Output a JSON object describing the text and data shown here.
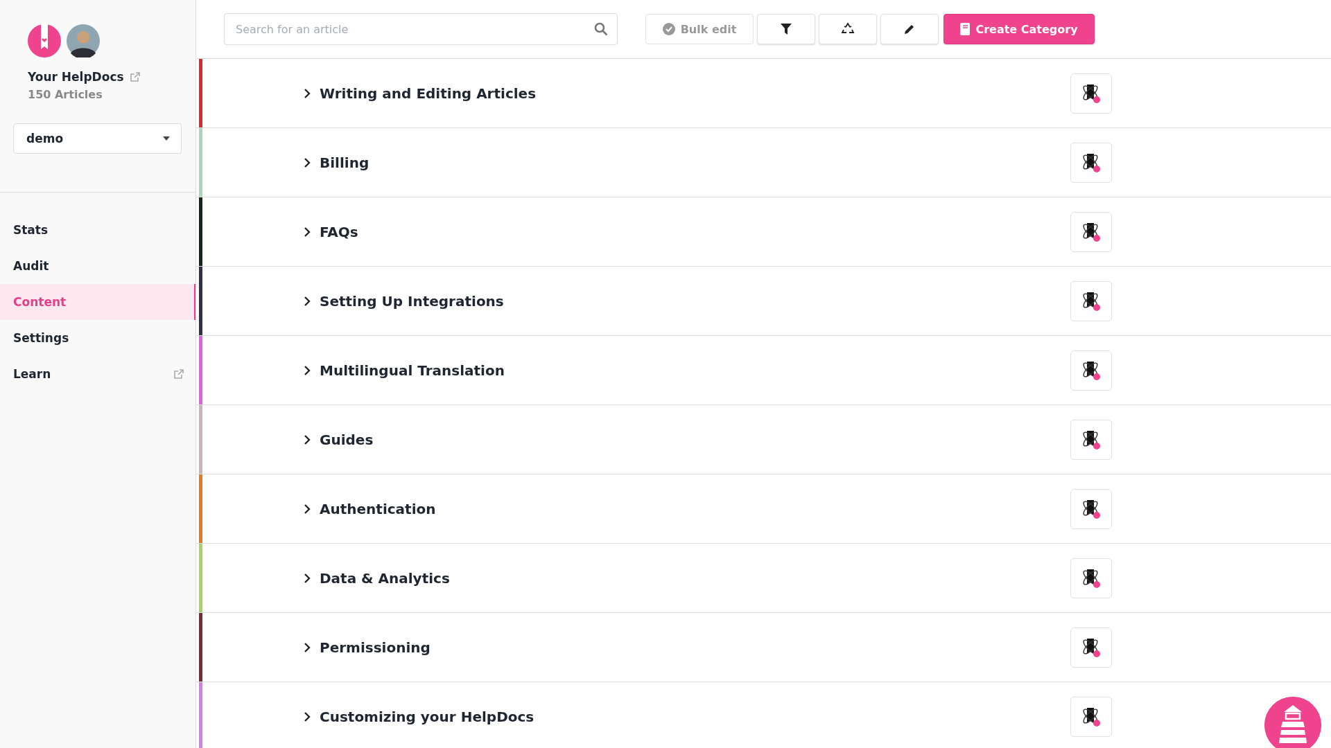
{
  "sidebar": {
    "site_name": "Your HelpDocs",
    "article_count": "150 Articles",
    "project_select": {
      "value": "demo"
    },
    "nav": [
      {
        "label": "Stats",
        "selected": false,
        "external": false
      },
      {
        "label": "Audit",
        "selected": false,
        "external": false
      },
      {
        "label": "Content",
        "selected": true,
        "external": false
      },
      {
        "label": "Settings",
        "selected": false,
        "external": false
      },
      {
        "label": "Learn",
        "selected": false,
        "external": true
      }
    ]
  },
  "toolbar": {
    "search": {
      "placeholder": "Search for an article"
    },
    "bulk_edit": "Bulk edit",
    "create_button": "Create Category"
  },
  "categories": [
    {
      "title": "Writing and Editing Articles",
      "color": "#e0262f",
      "expanded": false
    },
    {
      "title": "Billing",
      "color": "#a9d6bd",
      "expanded": false
    },
    {
      "title": "FAQs",
      "color": "#1b2418",
      "expanded": false
    },
    {
      "title": "Setting Up Integrations",
      "color": "#2e3244",
      "expanded": false
    },
    {
      "title": "Multilingual Translation",
      "color": "#e45ce4",
      "expanded": false
    },
    {
      "title": "Guides",
      "color": "#c9b5b9",
      "expanded": false
    },
    {
      "title": "Authentication",
      "color": "#e27c1f",
      "expanded": false
    },
    {
      "title": "Data & Analytics",
      "color": "#a9d463",
      "expanded": false
    },
    {
      "title": "Permissioning",
      "color": "#7b2b32",
      "expanded": false
    },
    {
      "title": "Customizing your HelpDocs",
      "color": "#d47ee8",
      "expanded": false
    }
  ]
}
